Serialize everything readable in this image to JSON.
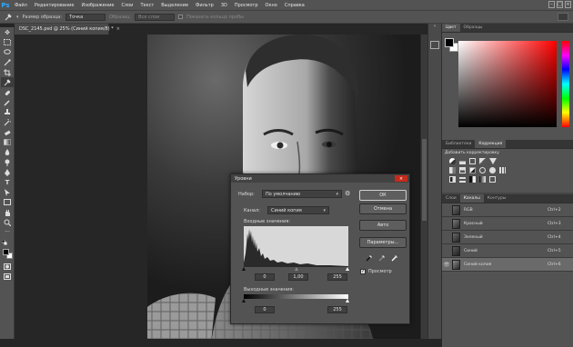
{
  "menu": {
    "logo": "Ps",
    "items": [
      "Файл",
      "Редактирование",
      "Изображение",
      "Слои",
      "Текст",
      "Выделение",
      "Фильтр",
      "3D",
      "Просмотр",
      "Окно",
      "Справка"
    ]
  },
  "window_controls": {
    "minimize": "–",
    "maximize": "□",
    "close": "×"
  },
  "options": {
    "sample_size_label": "Размер образца:",
    "sample_size_value": "Точка",
    "sample_label": "Образец:",
    "sample_value": "Все слои",
    "show_ring_label": "Показать кольцо пробы"
  },
  "document": {
    "tab_title": "DSC_2145.psd @ 25% (Синий копия/8) *",
    "tab_close": "×"
  },
  "color_panel": {
    "tabs": [
      "Цвет",
      "Образцы"
    ],
    "foreground": "#000000",
    "background": "#ffffff",
    "picked_hue": "#ff0000"
  },
  "adjustments_panel": {
    "tabs": [
      "Библиотеки",
      "Коррекция"
    ],
    "add_label": "Добавить корректировку"
  },
  "layers_panel": {
    "tabs": [
      "Слои",
      "Каналы",
      "Контуры"
    ],
    "channels": [
      {
        "name": "RGB",
        "shortcut": "Ctrl+2",
        "selected": false
      },
      {
        "name": "Красный",
        "shortcut": "Ctrl+3",
        "selected": false
      },
      {
        "name": "Зеленый",
        "shortcut": "Ctrl+4",
        "selected": false
      },
      {
        "name": "Синий",
        "shortcut": "Ctrl+5",
        "selected": false
      },
      {
        "name": "Синий копия",
        "shortcut": "Ctrl+6",
        "selected": true
      }
    ]
  },
  "levels": {
    "title": "Уровни",
    "close": "×",
    "preset_label": "Набор:",
    "preset_value": "По умолчанию",
    "channel_label": "Канал:",
    "channel_value": "Синий копия",
    "input_label": "Входные значения:",
    "input_black": "0",
    "input_gamma": "1,00",
    "input_white": "255",
    "output_label": "Выходные значения:",
    "output_black": "0",
    "output_white": "255",
    "ok": "ОК",
    "cancel": "Отмена",
    "auto": "Авто",
    "options": "Параметры...",
    "preview_label": "Просмотр",
    "preview_checked": true
  }
}
